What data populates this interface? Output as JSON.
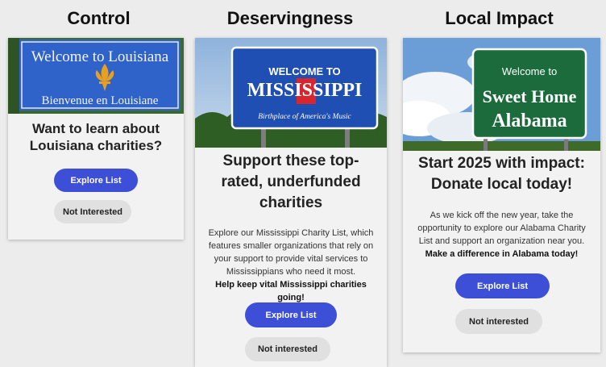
{
  "columns": [
    {
      "title": "Control",
      "sign": {
        "line1": "Welcome to Louisiana",
        "line2": "Bienvenue en Louisiane"
      },
      "headline": "Want to learn about Louisiana charities?",
      "body": "",
      "body_bold": "",
      "primary_button": "Explore List",
      "secondary_button": "Not Interested"
    },
    {
      "title": "Deservingness",
      "sign": {
        "line1": "WELCOME TO",
        "line2": "MISSISSIPPI",
        "line3": "Birthplace of America's Music"
      },
      "headline": "Support these top-rated, underfunded charities",
      "body": "Explore our Mississippi Charity List, which features smaller organizations that rely on your support to provide vital services to Mississippians who need it most.",
      "body_bold": "Help keep vital Mississippi charities going!",
      "primary_button": "Explore List",
      "secondary_button": "Not interested"
    },
    {
      "title": "Local Impact",
      "sign": {
        "line1": "Welcome to",
        "line2": "Sweet Home",
        "line3": "Alabama"
      },
      "headline": "Start 2025 with impact: Donate local today!",
      "body": "As we kick off the new year, take the opportunity to explore our Alabama Charity List and support an organization near you.",
      "body_bold": "Make a difference in Alabama today!",
      "primary_button": "Explore List",
      "secondary_button": "Not interested"
    }
  ],
  "colors": {
    "primary_button": "#3d4fd6",
    "secondary_button": "#e0e0e0",
    "louisiana_sign": "#2f63c9",
    "mississippi_sign": "#1f4fb3",
    "alabama_sign": "#1c6b3c"
  }
}
